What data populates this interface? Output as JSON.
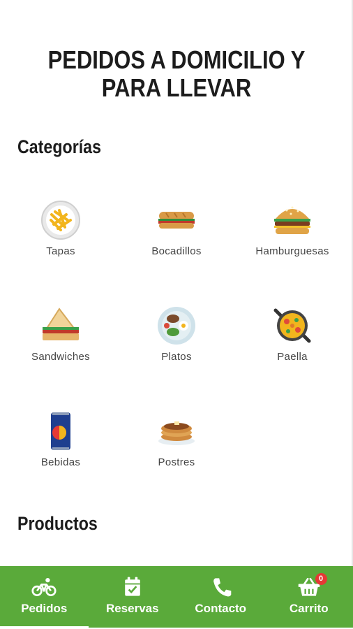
{
  "page": {
    "title_line1": "PEDIDOS A DOMICILIO Y",
    "title_line2": "PARA LLEVAR"
  },
  "sections": {
    "categories_title": "Categorías",
    "products_title": "Productos"
  },
  "categories": [
    {
      "label": "Tapas",
      "icon": "fries-icon"
    },
    {
      "label": "Bocadillos",
      "icon": "sandwich-baguette-icon"
    },
    {
      "label": "Hamburguesas",
      "icon": "burger-icon"
    },
    {
      "label": "Sandwiches",
      "icon": "sandwich-icon"
    },
    {
      "label": "Platos",
      "icon": "plate-icon"
    },
    {
      "label": "Paella",
      "icon": "paella-icon"
    },
    {
      "label": "Bebidas",
      "icon": "can-icon"
    },
    {
      "label": "Postres",
      "icon": "pancakes-icon"
    }
  ],
  "nav": {
    "items": [
      {
        "label": "Pedidos",
        "icon": "bicycle-icon",
        "active": true
      },
      {
        "label": "Reservas",
        "icon": "calendar-check-icon"
      },
      {
        "label": "Contacto",
        "icon": "phone-icon"
      },
      {
        "label": "Carrito",
        "icon": "basket-icon"
      }
    ],
    "cart_count": "0"
  },
  "colors": {
    "nav_bg": "#5aaa3a",
    "badge": "#e53935"
  }
}
